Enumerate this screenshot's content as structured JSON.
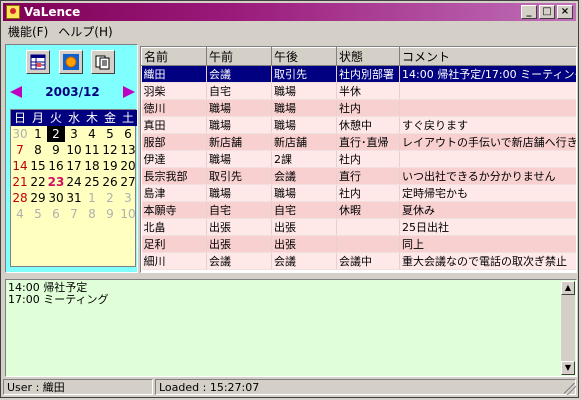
{
  "window": {
    "title": "VaLence",
    "controls": {
      "minimize": "_",
      "maximize": "□",
      "close": "×"
    }
  },
  "menu": {
    "items": [
      "機能(F)",
      "ヘルプ(H)"
    ]
  },
  "toolbar": {
    "icons": [
      "grid-icon",
      "circle-icon",
      "document-icon"
    ]
  },
  "calendar": {
    "title": "2003/12",
    "dow": [
      "日",
      "月",
      "火",
      "水",
      "木",
      "金",
      "土"
    ],
    "weeks": [
      [
        "30",
        "1",
        "2",
        "3",
        "4",
        "5",
        "6"
      ],
      [
        "7",
        "8",
        "9",
        "10",
        "11",
        "12",
        "13"
      ],
      [
        "14",
        "15",
        "16",
        "17",
        "18",
        "19",
        "20"
      ],
      [
        "21",
        "22",
        "23",
        "24",
        "25",
        "26",
        "27"
      ],
      [
        "28",
        "29",
        "30",
        "31",
        "1",
        "2",
        "3"
      ],
      [
        "4",
        "5",
        "6",
        "7",
        "8",
        "9",
        "10"
      ]
    ],
    "selected_day": "2",
    "highlight_day": "23"
  },
  "table": {
    "columns": [
      "名前",
      "午前",
      "午後",
      "状態",
      "コメント"
    ],
    "rows": [
      [
        "織田",
        "会議",
        "取引先",
        "社内別部署",
        "14:00 帰社予定/17:00 ミーティング"
      ],
      [
        "羽柴",
        "自宅",
        "職場",
        "半休",
        ""
      ],
      [
        "徳川",
        "職場",
        "職場",
        "社内",
        ""
      ],
      [
        "真田",
        "職場",
        "職場",
        "休憩中",
        "すぐ戻ります"
      ],
      [
        "服部",
        "新店舗",
        "新店舗",
        "直行･直帰",
        "レイアウトの手伝いで新店舗へ行き"
      ],
      [
        "伊達",
        "職場",
        "2課",
        "社内",
        ""
      ],
      [
        "長宗我部",
        "取引先",
        "会議",
        "直行",
        "いつ出社できるか分かりません"
      ],
      [
        "島津",
        "職場",
        "職場",
        "社内",
        "定時帰宅かも"
      ],
      [
        "本願寺",
        "自宅",
        "自宅",
        "休暇",
        "夏休み"
      ],
      [
        "北畠",
        "出張",
        "出張",
        "",
        "25日出社"
      ],
      [
        "足利",
        "出張",
        "出張",
        "",
        "同上"
      ],
      [
        "細川",
        "会議",
        "会議",
        "会議中",
        "重大会議なので電話の取次ぎ禁止"
      ]
    ],
    "selected_row": 0
  },
  "memo": {
    "text": "14:00 帰社予定\n17:00 ミーティング"
  },
  "status": {
    "user": "User : 織田",
    "loaded": "Loaded : 15:27:07"
  }
}
